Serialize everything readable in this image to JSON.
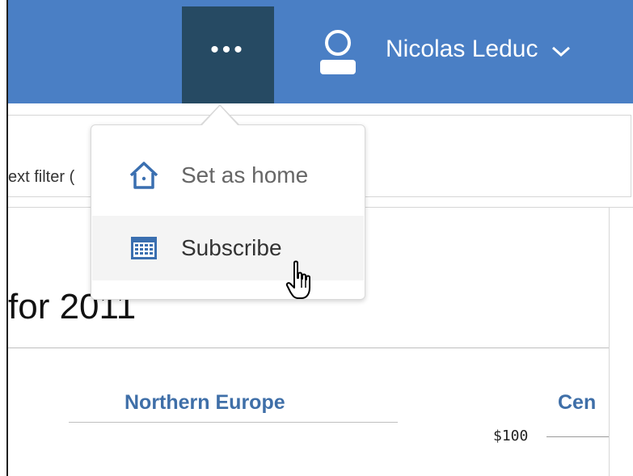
{
  "topbar": {
    "more_label": "•••",
    "user_name": "Nicolas Leduc",
    "icons": {
      "more": "more-dots-icon",
      "user": "user-icon",
      "dropdown": "chevron-down-icon"
    },
    "colors": {
      "bar": "#4a7fc5",
      "active": "#264a63"
    }
  },
  "filter_bar": {
    "text": "ext filter ("
  },
  "content": {
    "heading": "for 2011",
    "region_title": "Northern Europe",
    "region_title_2": "Cen",
    "axis_label": "$100"
  },
  "menu": {
    "items": [
      {
        "label": "Set as home",
        "icon": "home-icon"
      },
      {
        "label": "Subscribe",
        "icon": "calendar-icon"
      }
    ]
  }
}
